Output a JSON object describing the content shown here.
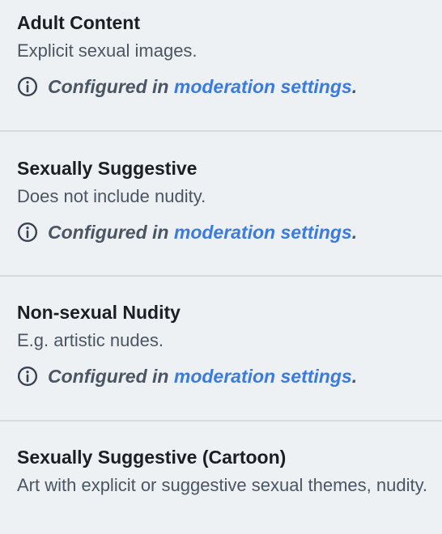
{
  "sections": [
    {
      "title": "Adult Content",
      "description": "Explicit sexual images.",
      "note_prefix": "Configured in ",
      "note_link": "moderation settings",
      "note_suffix": "."
    },
    {
      "title": "Sexually Suggestive",
      "description": "Does not include nudity.",
      "note_prefix": "Configured in ",
      "note_link": "moderation settings",
      "note_suffix": "."
    },
    {
      "title": "Non-sexual Nudity",
      "description": "E.g. artistic nudes.",
      "note_prefix": "Configured in ",
      "note_link": "moderation settings",
      "note_suffix": "."
    },
    {
      "title": "Sexually Suggestive (Cartoon)",
      "description": "Art with explicit or suggestive sexual themes, nudity."
    }
  ],
  "colors": {
    "background": "#edf1f3",
    "link": "#3b7be0",
    "divider": "#d6dbe0"
  },
  "icons": {
    "note": "info-circle-icon"
  }
}
